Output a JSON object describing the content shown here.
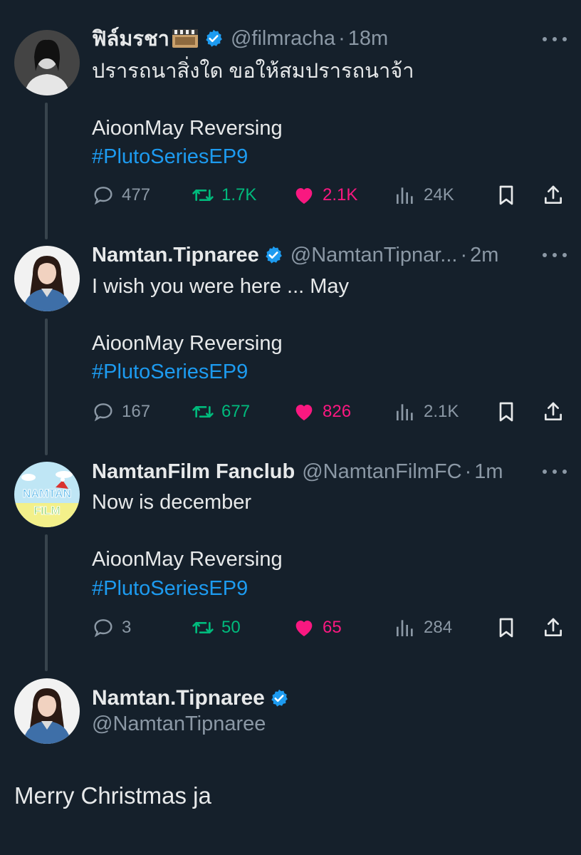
{
  "colors": {
    "background": "#15202b",
    "text": "#e7e9ea",
    "muted": "#8b98a5",
    "link": "#1d9bf0",
    "retweet": "#00ba7c",
    "like": "#f91880",
    "thread_line": "#38444d"
  },
  "tweets": [
    {
      "name": "ฟิล์มรชา",
      "handle": "@filmracha",
      "time": "18m",
      "line1": "ปรารถนาสิ่งใด ขอให้สมปรารถนาจ้า",
      "line2": "AioonMay Reversing",
      "hashtag": "#PlutoSeriesEP9",
      "replies": "477",
      "retweets": "1.7K",
      "likes": "2.1K",
      "views": "24K",
      "liked": true
    },
    {
      "name": "Namtan.Tipnaree",
      "handle": "@NamtanTipnar...",
      "time": "2m",
      "line1": "I wish you were here ... May",
      "line2": "AioonMay Reversing",
      "hashtag": "#PlutoSeriesEP9",
      "replies": "167",
      "retweets": "677",
      "likes": "826",
      "views": "2.1K",
      "liked": true
    },
    {
      "name": "NamtanFilm Fanclub",
      "handle": "@NamtanFilmFC",
      "time": "1m",
      "line1": "Now is december",
      "line2": "AioonMay Reversing",
      "hashtag": "#PlutoSeriesEP9",
      "replies": "3",
      "retweets": "50",
      "likes": "65",
      "views": "284",
      "liked": true
    }
  ],
  "main_tweet": {
    "name": "Namtan.Tipnaree",
    "handle": "@NamtanTipnaree",
    "text": "Merry Christmas ja"
  },
  "separator": "·",
  "icons": {
    "verified": "verified-badge-icon",
    "reply": "reply-bubble-icon",
    "retweet": "retweet-icon",
    "like": "heart-icon",
    "views": "views-chart-icon",
    "bookmark": "bookmark-icon",
    "share": "share-icon",
    "more": "more-dots-icon"
  }
}
